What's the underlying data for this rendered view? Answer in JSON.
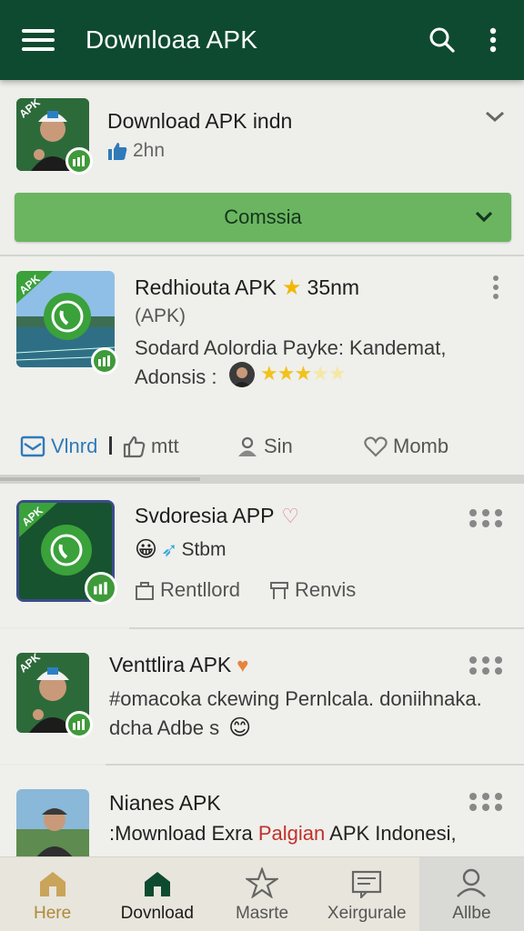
{
  "appbar": {
    "title": "Downloaa APK",
    "menu_icon": "hamburger-menu-icon",
    "search_icon": "search-icon",
    "more_icon": "more-vert-icon",
    "color": "#0e4a30"
  },
  "card1": {
    "title": "Download APK indn",
    "meta": "2hn",
    "select_label": "Comssia",
    "accent": "#6bb560"
  },
  "card2": {
    "title": "Redhiouta APK",
    "rating_text": "35nm",
    "subtitle": "(APK)",
    "body_line1": "Sodard Aolordia Payke: Kandemat,",
    "body_line2": "Adonsis :",
    "stars_filled": 3,
    "stars_total": 5,
    "actions": [
      {
        "label": "Vlnrd",
        "icon": "email-icon"
      },
      {
        "label": "mtt",
        "icon": "thumbs-up-icon"
      },
      {
        "label": "Sin",
        "icon": "person-icon"
      },
      {
        "label": "Momb",
        "icon": "heart-icon"
      }
    ]
  },
  "card3": {
    "title": "Svdoresia APP",
    "meta": "Stbm",
    "actions": [
      {
        "label": "Rentllord",
        "icon": "bag-icon"
      },
      {
        "label": "Renvis",
        "icon": "table-icon"
      }
    ]
  },
  "card4": {
    "title": "Venttlira APK",
    "body_line1": "#omacoka ckewing Pernlcala. doniihnaka.",
    "body_line2": "dcha Adbe s"
  },
  "card5": {
    "title": "Nianes APK",
    "body_prefix": ":Mownload Exra ",
    "body_highlight": "Palgian",
    "body_suffix": " APK Indonesi,",
    "highlight_color": "#c0312b"
  },
  "bottom_nav": [
    {
      "label": "Here",
      "icon": "home-icon"
    },
    {
      "label": "Dovnload",
      "icon": "download-home-icon"
    },
    {
      "label": "Masrte",
      "icon": "star-outline-icon"
    },
    {
      "label": "Xeirgurale",
      "icon": "news-icon"
    },
    {
      "label": "Allbe",
      "icon": "account-icon"
    }
  ]
}
